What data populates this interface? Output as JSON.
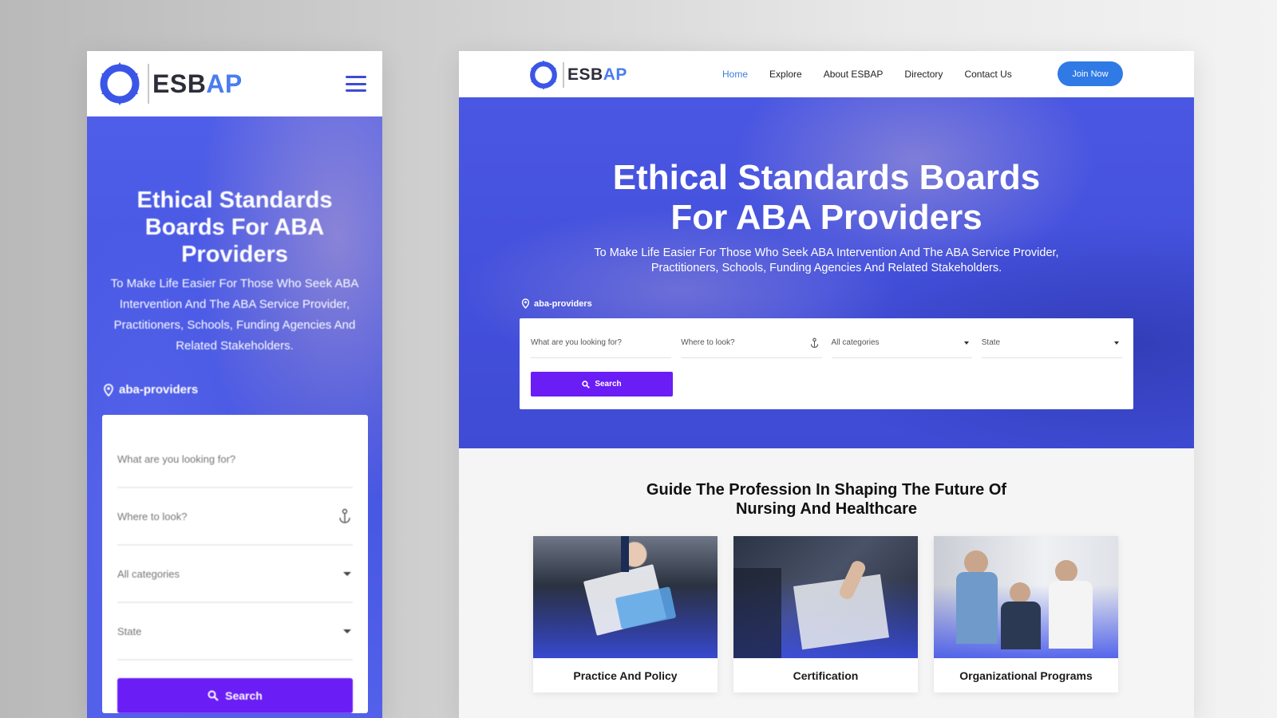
{
  "brand": {
    "name_part1": "ESB",
    "name_part2": "AP",
    "colors": {
      "primary_blue": "#4a57e2",
      "accent_blue": "#2f7ae5",
      "purple_button": "#6a1df5",
      "logo_blue": "#4a7cf0"
    }
  },
  "mobile": {
    "menu_icon": "hamburger-icon",
    "hero": {
      "title": "Ethical Standards Boards For ABA Providers",
      "subtitle": "To Make Life Easier For Those Who Seek ABA Intervention And The ABA Service Provider, Practitioners, Schools, Funding Agencies And Related Stakeholders.",
      "tag": "aba-providers"
    },
    "search": {
      "what_placeholder": "What are you looking for?",
      "where_placeholder": "Where to look?",
      "category_value": "All categories",
      "state_value": "State",
      "button_label": "Search"
    }
  },
  "desktop": {
    "nav": [
      "Home",
      "Explore",
      "About ESBAP",
      "Directory",
      "Contact Us"
    ],
    "active_nav": "Home",
    "join_label": "Join Now",
    "hero": {
      "title_line1": "Ethical Standards Boards",
      "title_line2": "For ABA Providers",
      "subtitle_line1": "To Make Life Easier For Those Who Seek ABA Intervention And The ABA Service Provider,",
      "subtitle_line2": "Practitioners, Schools, Funding Agencies And Related Stakeholders.",
      "tag": "aba-providers"
    },
    "search": {
      "what_placeholder": "What are you looking for?",
      "where_placeholder": "Where to look?",
      "category_value": "All categories",
      "state_value": "State",
      "button_label": "Search"
    },
    "section": {
      "title_line1": "Guide The Profession In Shaping The Future Of",
      "title_line2": "Nursing And Healthcare"
    },
    "cards": [
      {
        "label": "Practice And Policy"
      },
      {
        "label": "Certification"
      },
      {
        "label": "Organizational Programs"
      }
    ]
  }
}
